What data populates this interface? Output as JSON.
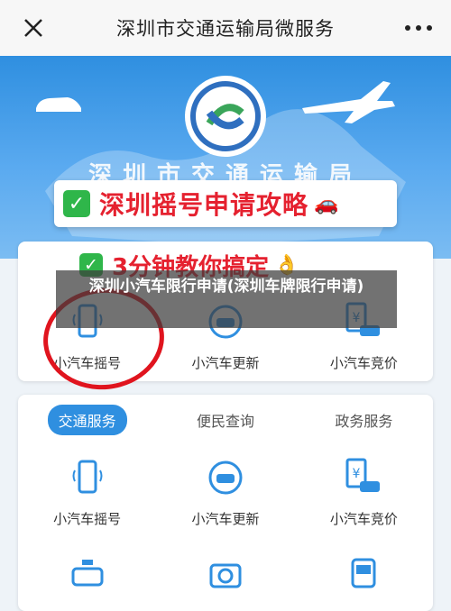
{
  "nav": {
    "title": "深圳市交通运输局微服务"
  },
  "hero": {
    "agency": "深圳市交通运输局",
    "banner_text": "深圳摇号申请攻略",
    "tag2_text": "3分钟教你搞定"
  },
  "overlay": {
    "text": "深圳小汽车限行申请(深圳车牌限行申请)"
  },
  "quick_services": [
    {
      "label": "小汽车摇号",
      "icon": "phone-icon"
    },
    {
      "label": "小汽车更新",
      "icon": "car-refresh-icon"
    },
    {
      "label": "小汽车竞价",
      "icon": "yen-car-icon"
    }
  ],
  "tabs": [
    {
      "label": "交通服务",
      "active": true
    },
    {
      "label": "便民查询",
      "active": false
    },
    {
      "label": "政务服务",
      "active": false
    }
  ],
  "services": [
    {
      "label": "小汽车摇号",
      "icon": "phone-icon"
    },
    {
      "label": "小汽车更新",
      "icon": "car-refresh-icon"
    },
    {
      "label": "小汽车竞价",
      "icon": "yen-car-icon"
    }
  ],
  "services_row2": [
    {
      "icon": "taxi-icon"
    },
    {
      "icon": "camera-icon"
    },
    {
      "icon": "bus-icon"
    }
  ],
  "colors": {
    "primary": "#2f8fe0",
    "accent_red": "#e5212f",
    "check_green": "#2fb64a"
  }
}
